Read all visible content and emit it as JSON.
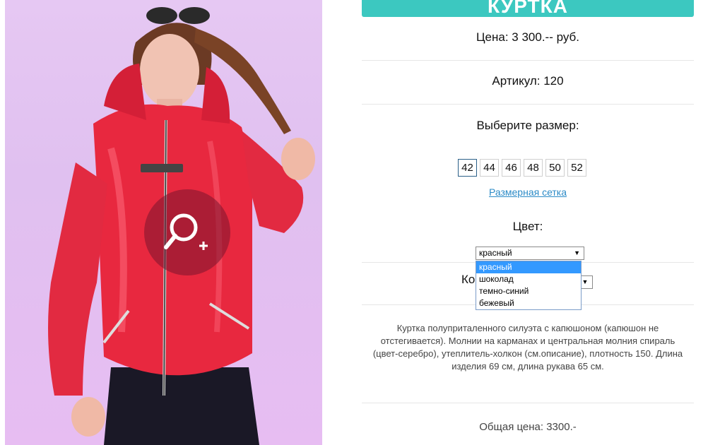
{
  "product": {
    "title": "КУРТКА",
    "price": "Цена: 3 300.-- руб.",
    "article": "Артикул: 120",
    "size_prompt": "Выберите размер:",
    "sizes": [
      "42",
      "44",
      "46",
      "48",
      "50",
      "52"
    ],
    "selected_size": "42",
    "size_chart_link": "Размерная сетка",
    "color_label": "Цвет:",
    "color_selected": "красный",
    "color_options": [
      "красный",
      "шоколад",
      "темно-синий",
      "бежевый"
    ],
    "quantity_label_partial": "Ко",
    "description": "Куртка полуприталенного силуэта с капюшоном (капюшон не отстегивается). Молнии на карманах и центральная молния спираль (цвет-серебро), утеплитель-холкон (см.описание), плотность 150. Длина изделия 69 см, длина рукава 65 см.",
    "total": "Общая цена: 3300.-"
  },
  "colors": {
    "accent": "#3cc8c0",
    "link": "#2c8bc7",
    "highlight": "#3399ff",
    "jacket": "#e8283f"
  },
  "icons": {
    "zoom": "zoom-in-icon",
    "dropdown_arrow": "triangle-down-icon"
  }
}
